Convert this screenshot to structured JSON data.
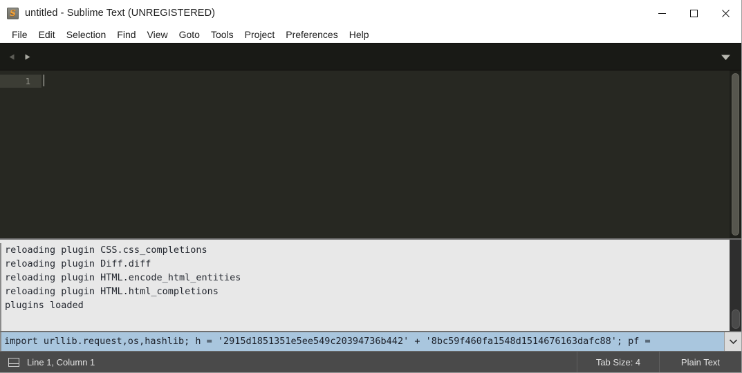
{
  "window": {
    "title": "untitled - Sublime Text (UNREGISTERED)",
    "icon": "sublime-text-icon",
    "icon_glyph": "S",
    "controls": {
      "minimize": "minimize-button",
      "maximize": "maximize-button",
      "close": "close-button"
    }
  },
  "menu": {
    "items": [
      {
        "label": "File"
      },
      {
        "label": "Edit"
      },
      {
        "label": "Selection"
      },
      {
        "label": "Find"
      },
      {
        "label": "View"
      },
      {
        "label": "Goto"
      },
      {
        "label": "Tools"
      },
      {
        "label": "Project"
      },
      {
        "label": "Preferences"
      },
      {
        "label": "Help"
      }
    ]
  },
  "tab_bar": {
    "scroll_left_icon": "triangle-left-icon",
    "scroll_right_icon": "triangle-right-icon",
    "menu_icon": "chevron-down-icon",
    "tabs": []
  },
  "editor": {
    "line_numbers": [
      "1"
    ],
    "content": "",
    "scrollbar": "editor-scrollbar"
  },
  "console": {
    "lines": [
      "reloading plugin CSS.css_completions",
      "reloading plugin Diff.diff",
      "reloading plugin HTML.encode_html_entities",
      "reloading plugin HTML.html_completions",
      "plugins loaded"
    ],
    "input": {
      "value": "import urllib.request,os,hashlib; h = '2915d1851351e5ee549c20394736b442' + '8bc59f460fa1548d1514676163dafc88'; pf = ",
      "selected": true,
      "dropdown_icon": "chevron-down-icon"
    }
  },
  "status_bar": {
    "layout_icon": "panel-layout-icon",
    "position": "Line 1, Column 1",
    "tab_size": "Tab Size: 4",
    "syntax": "Plain Text"
  },
  "colors": {
    "titlebar_bg": "#ffffff",
    "tabbar_bg": "#191a16",
    "editor_bg": "#272822",
    "gutter_active": "#3c3d35",
    "console_bg": "#e8e8e8",
    "console_input_selection": "#a9c6de",
    "statusbar_bg": "#4a4a4a",
    "icon_accent": "#f2a33c"
  }
}
